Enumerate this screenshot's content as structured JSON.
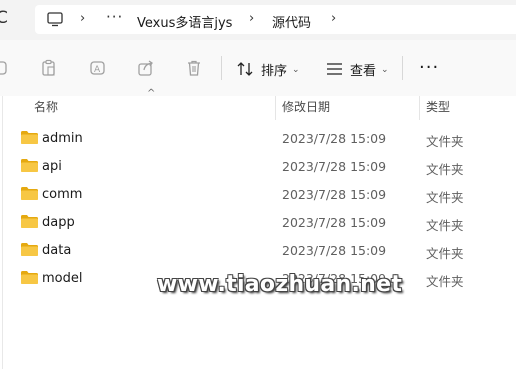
{
  "address": {
    "left_glyph": "C",
    "dots": "···",
    "path": [
      "Vexus多语言jys",
      "源代码"
    ]
  },
  "toolbar": {
    "sort_label": "排序",
    "view_label": "查看",
    "more": "···"
  },
  "columns": {
    "name": "名称",
    "modified": "修改日期",
    "type": "类型"
  },
  "files": [
    {
      "name": "admin",
      "modified": "2023/7/28 15:09",
      "type": "文件夹"
    },
    {
      "name": "api",
      "modified": "2023/7/28 15:09",
      "type": "文件夹"
    },
    {
      "name": "comm",
      "modified": "2023/7/28 15:09",
      "type": "文件夹"
    },
    {
      "name": "dapp",
      "modified": "2023/7/28 15:09",
      "type": "文件夹"
    },
    {
      "name": "data",
      "modified": "2023/7/28 15:09",
      "type": "文件夹"
    },
    {
      "name": "model",
      "modified": "2023/7/28 15:09",
      "type": "文件夹"
    }
  ],
  "watermark": "www.tiaozhuan.net",
  "colors": {
    "folder": "#f7c744",
    "folder_tab": "#e5a910",
    "icon_gray": "#a0a0a0"
  }
}
